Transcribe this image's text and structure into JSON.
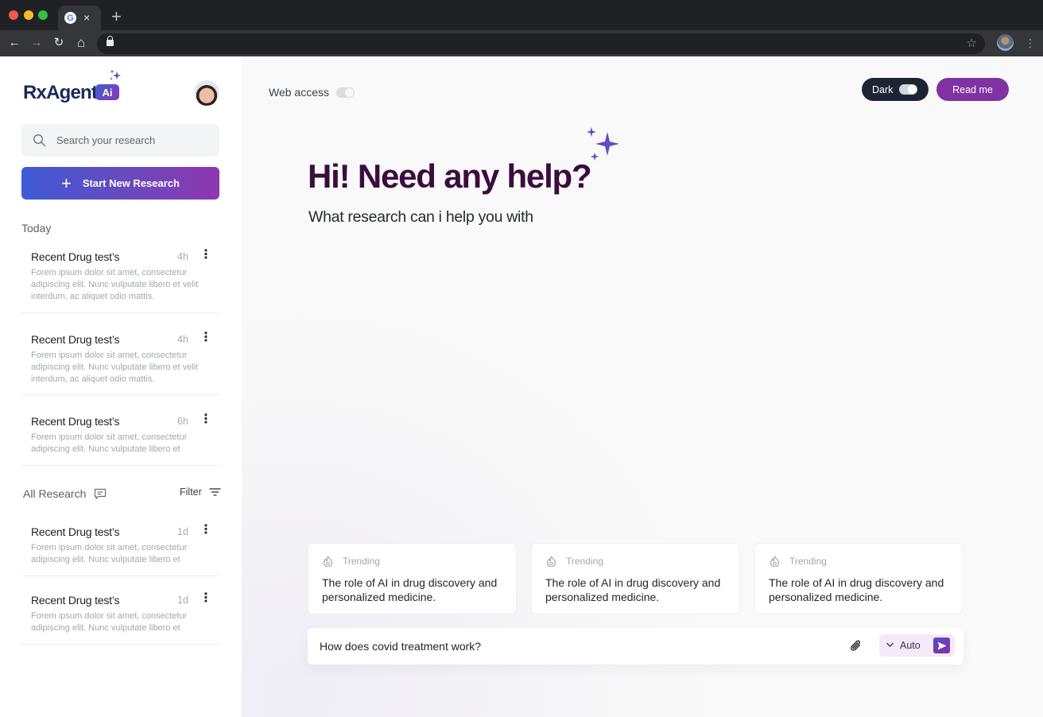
{
  "browser": {
    "tab_close_glyph": "×",
    "new_tab_glyph": "+",
    "favicon_letter": "G",
    "back_glyph": "←",
    "forward_glyph": "→",
    "reload_glyph": "↻",
    "home_glyph": "⌂",
    "star_glyph": "☆",
    "menu_glyph": "⋮",
    "url": ""
  },
  "sidebar": {
    "logo_text": "RxAgent",
    "logo_badge": "Ai",
    "search_placeholder": "Search your research",
    "new_research_label": "Start New Research",
    "new_research_icon": "+",
    "today_label": "Today",
    "today_items": [
      {
        "title": "Recent Drug test’s",
        "time": "4h",
        "description": "Forem ipsum dolor sit amet, consectetur adipiscing elit. Nunc vulputate libero et velit interdum, ac aliquet odio mattis."
      },
      {
        "title": "Recent Drug test’s",
        "time": "4h",
        "description": "Forem ipsum dolor sit amet, consectetur adipiscing elit. Nunc vulputate libero et velit interdum, ac aliquet odio mattis."
      },
      {
        "title": "Recent Drug test’s",
        "time": "6h",
        "description": "Forem ipsum dolor sit amet, consectetur adipiscing elit. Nunc vulputate libero et"
      }
    ],
    "all_research_label": "All Research",
    "filter_label": "Filter",
    "all_items": [
      {
        "title": "Recent Drug test’s",
        "time": "1d",
        "description": "Forem ipsum dolor sit amet, consectetur adipiscing elit. Nunc vulputate libero et"
      },
      {
        "title": "Recent Drug test’s",
        "time": "1d",
        "description": "Forem ipsum dolor sit amet, consectetur adipiscing elit. Nunc vulputate libero et"
      }
    ],
    "item_menu_glyph": "⋮"
  },
  "main": {
    "web_access_label": "Web access",
    "web_access_enabled": false,
    "dark_label": "Dark",
    "dark_enabled": true,
    "read_me_label": "Read me",
    "hero_title": "Hi! Need any help?",
    "hero_subtitle": "What research can i help you with",
    "cards": [
      {
        "tag": "Trending",
        "text": "The role of AI in drug discovery and personalized medicine."
      },
      {
        "tag": "Trending",
        "text": "The role of AI in drug discovery and personalized medicine."
      },
      {
        "tag": "Trending",
        "text": "The role of AI in drug discovery and personalized medicine."
      }
    ],
    "prompt_value": "How does covid treatment work?",
    "mode_label": "Auto"
  },
  "colors": {
    "brand_navy": "#1c2a5a",
    "brand_purple": "#7f33a3",
    "gradient_start": "#3e5ad6",
    "gradient_end": "#8e38ae",
    "hero_title": "#3b0d3f",
    "dark_pill": "#1d2535"
  }
}
